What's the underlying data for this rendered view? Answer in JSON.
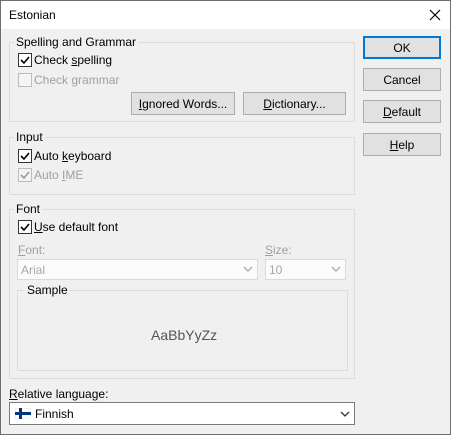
{
  "window": {
    "title": "Estonian"
  },
  "spelling_group": {
    "legend": "Spelling and Grammar",
    "check_spelling": {
      "pre": "Check ",
      "key": "s",
      "post": "pelling",
      "checked": true
    },
    "check_grammar": {
      "pre": "Check ",
      "key": "g",
      "post": "rammar",
      "checked": false,
      "enabled": false
    },
    "ignored_words_button": {
      "pre": "",
      "key": "I",
      "post": "gnored Words..."
    },
    "dictionary_button": {
      "pre": "",
      "key": "D",
      "post": "ictionary..."
    }
  },
  "input_group": {
    "legend": "Input",
    "auto_keyboard": {
      "pre": "Auto ",
      "key": "k",
      "post": "eyboard",
      "checked": true
    },
    "auto_ime": {
      "pre": "Auto ",
      "key": "I",
      "post": "ME",
      "checked": true,
      "enabled": false
    }
  },
  "font_group": {
    "legend": "Font",
    "use_default_font": {
      "pre": "",
      "key": "U",
      "post": "se default font",
      "checked": true
    },
    "font_label": {
      "pre": "",
      "key": "F",
      "post": "ont:"
    },
    "font_value": "Arial",
    "size_label": {
      "pre": "",
      "key": "S",
      "post": "ize:"
    },
    "size_value": "10",
    "sample_legend": "Sample",
    "sample_text": "AaBbYyZz"
  },
  "relative_language": {
    "label": {
      "pre": "",
      "key": "R",
      "post": "elative language:"
    },
    "value": "Finnish",
    "flag_icon": "finland-flag-icon"
  },
  "buttons": {
    "ok": {
      "pre": "OK",
      "key": "",
      "post": ""
    },
    "cancel": {
      "pre": "Cancel",
      "key": "",
      "post": ""
    },
    "default": {
      "pre": "",
      "key": "D",
      "post": "efault"
    },
    "help": {
      "pre": "",
      "key": "H",
      "post": "elp"
    }
  },
  "colors": {
    "default_button_border": "#0078d7",
    "flag_blue": "#003580"
  }
}
